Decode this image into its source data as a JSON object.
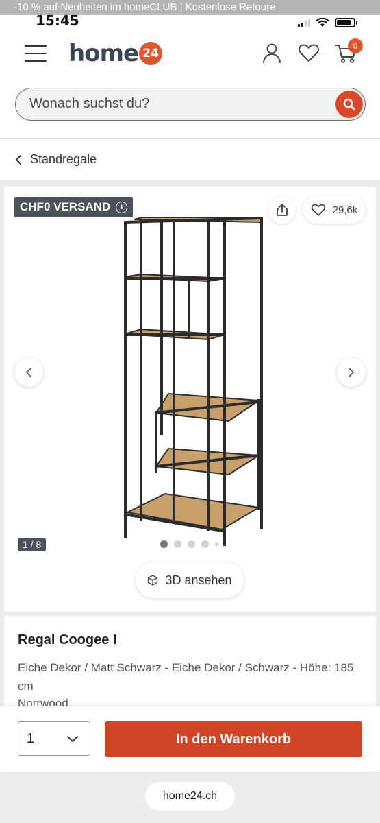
{
  "promo": {
    "text": "-10 % auf Neuheiten im homeCLUB | Kostenlose Retoure"
  },
  "status_bar": {
    "time": "15:45"
  },
  "header": {
    "logo_text": "home",
    "logo_badge": "24",
    "cart_count": "0",
    "search": {
      "placeholder": "Wonach suchst du?"
    }
  },
  "breadcrumb": {
    "label": "Standregale"
  },
  "gallery": {
    "shipping_badge": "CHF0 VERSAND",
    "info_glyph": "i",
    "likes": "29,6k",
    "counter": "1 / 8",
    "view_3d_label": "3D ansehen"
  },
  "product": {
    "title": "Regal Coogee I",
    "description": "Eiche Dekor / Matt Schwarz - Eiche Dekor / Schwarz - Höhe: 185 cm",
    "brand": "Norrwood"
  },
  "buy": {
    "quantity": "1",
    "add_to_cart": "In den Warenkorb"
  },
  "browser": {
    "url": "home24.ch"
  },
  "colors": {
    "accent": "#d9482a",
    "badge": "#4c5358"
  }
}
